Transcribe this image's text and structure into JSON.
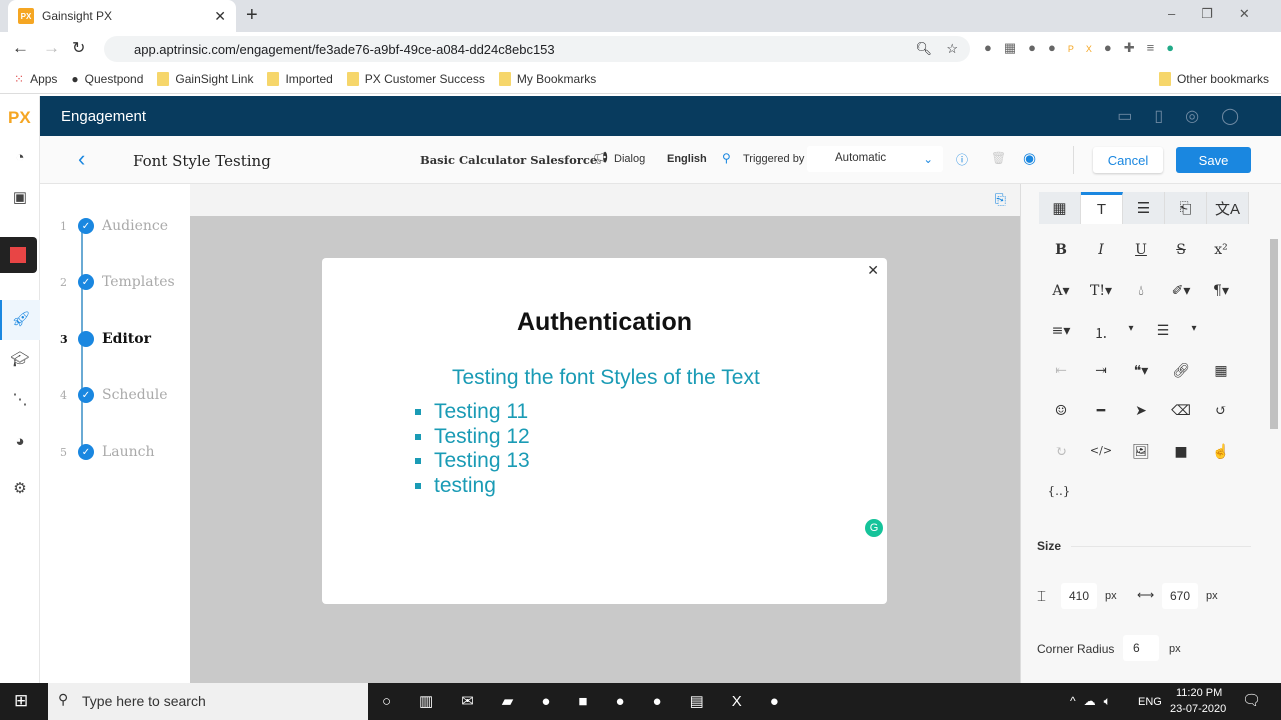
{
  "browser": {
    "tab_title": "Gainsight PX",
    "url": "app.aptrinsic.com/engagement/fe3ade76-a9bf-49ce-a084-dd24c8ebc153",
    "bookmarks": [
      "Apps",
      "Questpond",
      "GainSight Link",
      "Imported",
      "PX Customer Success",
      "My Bookmarks"
    ],
    "other_bookmarks": "Other bookmarks"
  },
  "app": {
    "logo": "PX",
    "section": "Engagement"
  },
  "subheader": {
    "title": "Font Style Testing",
    "product": "Basic Calculator Salesforce",
    "type": "Dialog",
    "language": "English",
    "triggered_label": "Triggered by",
    "trigger_value": "Automatic",
    "cancel": "Cancel",
    "save": "Save"
  },
  "steps": [
    {
      "n": "1",
      "label": "Audience"
    },
    {
      "n": "2",
      "label": "Templates"
    },
    {
      "n": "3",
      "label": "Editor"
    },
    {
      "n": "4",
      "label": "Schedule"
    },
    {
      "n": "5",
      "label": "Launch"
    }
  ],
  "dialog": {
    "heading": "Authentication",
    "subtitle": "Testing the font Styles of the Text",
    "bullets": [
      "Testing 11",
      "Testing 12",
      "Testing 13",
      "testing"
    ],
    "text_color": "#1a9bb5"
  },
  "panel": {
    "size_label": "Size",
    "height": "410",
    "width": "670",
    "unit": "px",
    "corner_label": "Corner Radius",
    "corner": "6",
    "variables": "{..}"
  },
  "taskbar": {
    "search": "Type here to search",
    "lang": "ENG",
    "time": "11:20 PM",
    "date": "23-07-2020"
  },
  "colors": {
    "accent": "#1a87e0",
    "header": "#083b5e"
  }
}
